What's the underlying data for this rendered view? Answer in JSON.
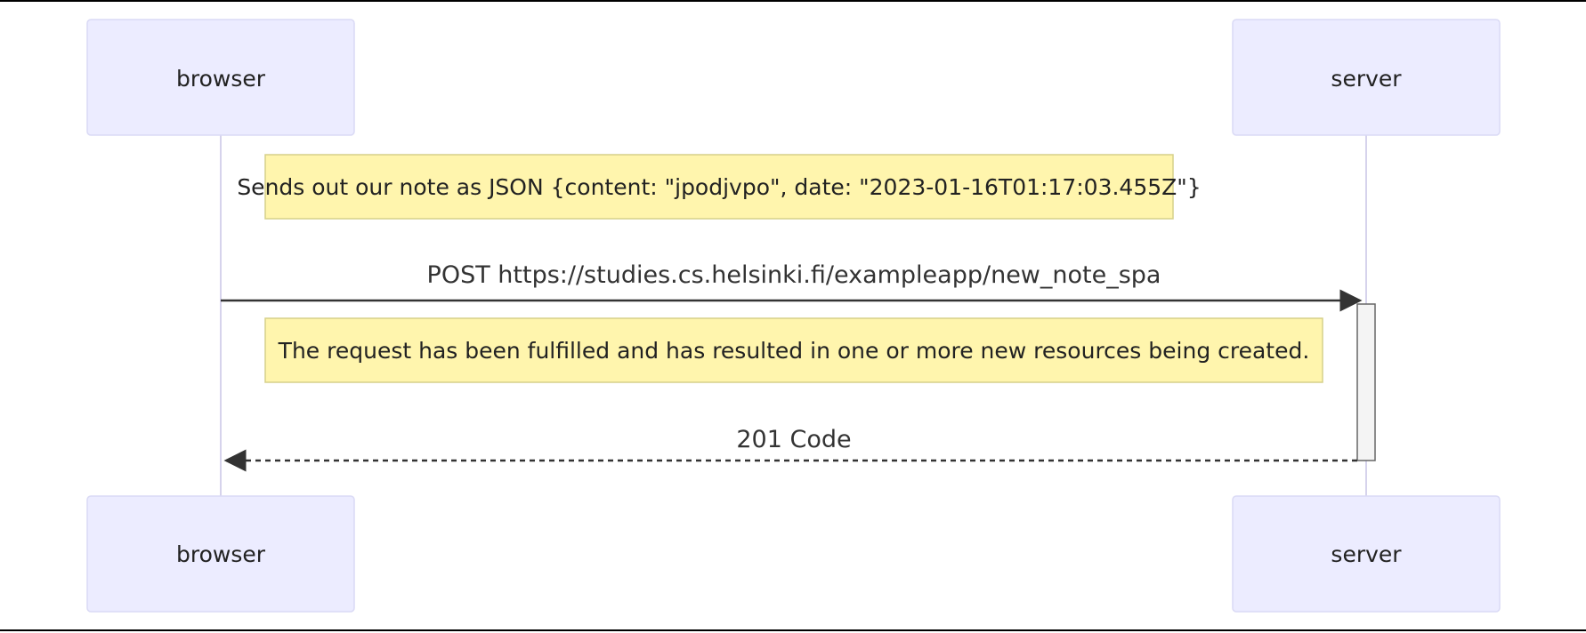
{
  "diagram": {
    "actors": {
      "browser": "browser",
      "server": "server"
    },
    "notes": [
      {
        "text": "Sends out our note as JSON {content: \"jpodjvpo\", date: \"2023-01-16T01:17:03.455Z\"}"
      },
      {
        "text": "The request has been fulfilled and has resulted in one or more new resources being created."
      }
    ],
    "messages": [
      {
        "from": "browser",
        "to": "server",
        "label": "POST https://studies.cs.helsinki.fi/exampleapp/new_note_spa",
        "style": "solid"
      },
      {
        "from": "server",
        "to": "browser",
        "label": "201 Code",
        "style": "dashed"
      }
    ],
    "colors": {
      "actor_fill": "#ECECFF",
      "note_fill": "#FFF5AD",
      "line": "#333333"
    }
  }
}
